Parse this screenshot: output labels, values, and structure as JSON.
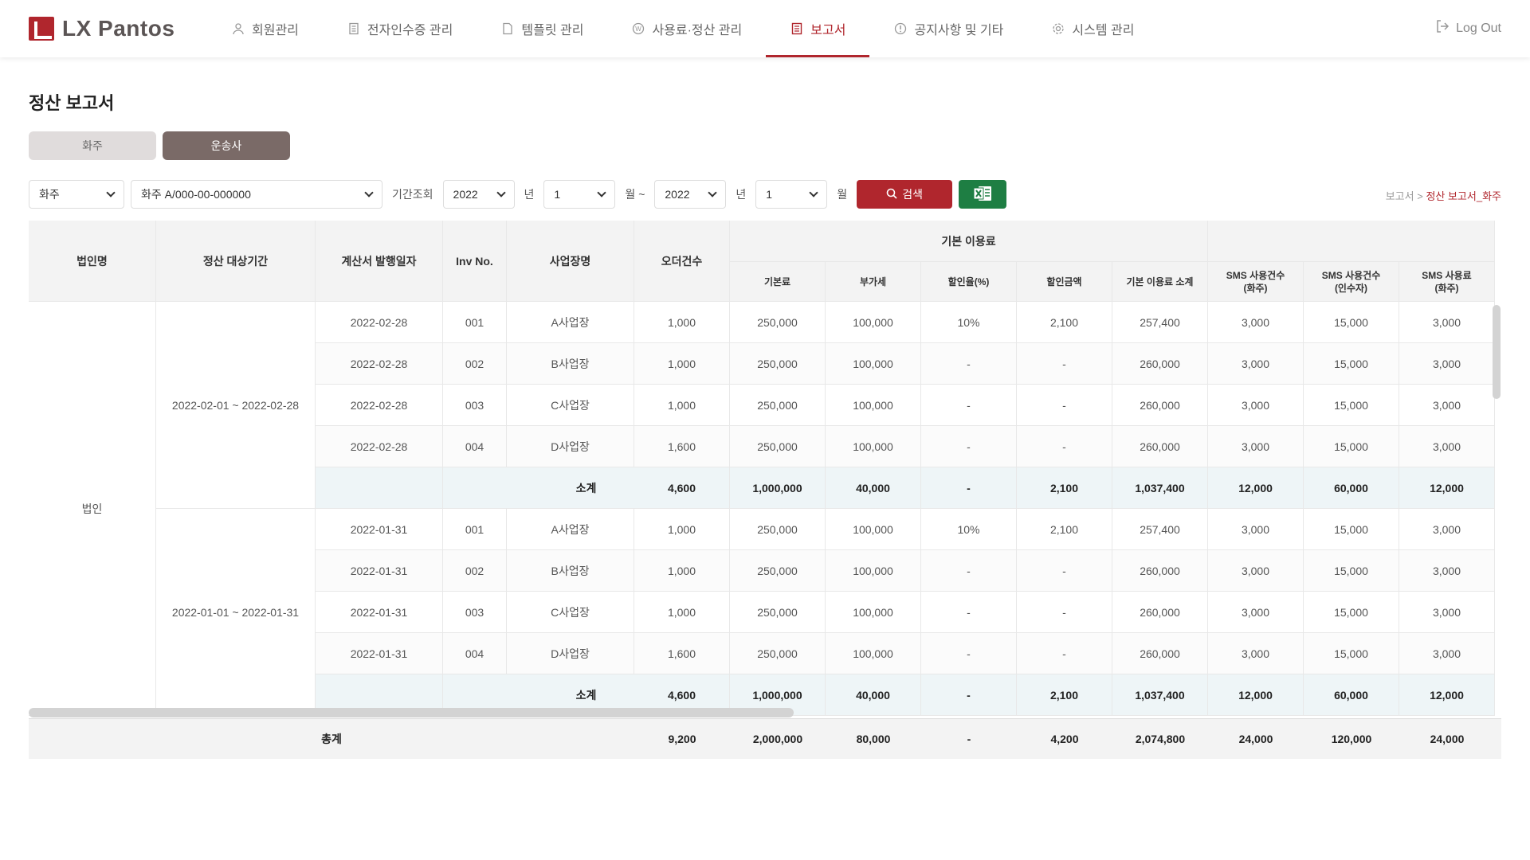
{
  "brand": {
    "name": "LX Pantos",
    "accent": "#b0262d"
  },
  "nav": [
    {
      "label": "회원관리",
      "icon": "user-icon",
      "active": false
    },
    {
      "label": "전자인수증 관리",
      "icon": "receipt-icon",
      "active": false
    },
    {
      "label": "템플릿 관리",
      "icon": "document-icon",
      "active": false
    },
    {
      "label": "사용료·정산 관리",
      "icon": "won-icon",
      "active": false
    },
    {
      "label": "보고서",
      "icon": "report-icon",
      "active": true
    },
    {
      "label": "공지사항 및 기타",
      "icon": "info-icon",
      "active": false
    },
    {
      "label": "시스템 관리",
      "icon": "gear-icon",
      "active": false
    }
  ],
  "logout": "Log Out",
  "page_title": "정산 보고서",
  "segments": {
    "shipper": "화주",
    "carrier": "운송사"
  },
  "filters": {
    "type": "화주",
    "company": "화주 A/000-00-000000",
    "period_label": "기간조회",
    "from_year": "2022",
    "year_unit": "년",
    "from_month": "1",
    "month_unit": "월 ~",
    "to_year": "2022",
    "to_month": "1",
    "month_unit_end": "월",
    "search_label": "검색"
  },
  "breadcrumb": {
    "parent": "보고서 >",
    "current": "정산 보고서_화주"
  },
  "table": {
    "headers": {
      "corp": "법인명",
      "period": "정산 대상기간",
      "issue_date": "계산서 발행일자",
      "inv": "Inv No.",
      "site": "사업장명",
      "orders": "오더건수",
      "basic_group": "기본 이용료",
      "base": "기본료",
      "vat": "부가세",
      "disc_rate": "할인율(%)",
      "disc_amt": "할인금액",
      "basic_sub": "기본 이용료 소계",
      "sms_cnt_shipper": "SMS 사용건수\n(화주)",
      "sms_cnt_receiver": "SMS 사용건수\n(인수자)",
      "sms_fee_shipper": "SMS 사용료\n(화주)"
    },
    "corp_name": "법인",
    "groups": [
      {
        "period": "2022-02-01 ~ 2022-02-28",
        "rows": [
          [
            "2022-02-28",
            "001",
            "A사업장",
            "1,000",
            "250,000",
            "100,000",
            "10%",
            "2,100",
            "257,400",
            "3,000",
            "15,000",
            "3,000"
          ],
          [
            "2022-02-28",
            "002",
            "B사업장",
            "1,000",
            "250,000",
            "100,000",
            "-",
            "-",
            "260,000",
            "3,000",
            "15,000",
            "3,000"
          ],
          [
            "2022-02-28",
            "003",
            "C사업장",
            "1,000",
            "250,000",
            "100,000",
            "-",
            "-",
            "260,000",
            "3,000",
            "15,000",
            "3,000"
          ],
          [
            "2022-02-28",
            "004",
            "D사업장",
            "1,600",
            "250,000",
            "100,000",
            "-",
            "-",
            "260,000",
            "3,000",
            "15,000",
            "3,000"
          ]
        ],
        "subtotal": [
          "소계",
          "4,600",
          "1,000,000",
          "40,000",
          "-",
          "2,100",
          "1,037,400",
          "12,000",
          "60,000",
          "12,000"
        ]
      },
      {
        "period": "2022-01-01 ~ 2022-01-31",
        "rows": [
          [
            "2022-01-31",
            "001",
            "A사업장",
            "1,000",
            "250,000",
            "100,000",
            "10%",
            "2,100",
            "257,400",
            "3,000",
            "15,000",
            "3,000"
          ],
          [
            "2022-01-31",
            "002",
            "B사업장",
            "1,000",
            "250,000",
            "100,000",
            "-",
            "-",
            "260,000",
            "3,000",
            "15,000",
            "3,000"
          ],
          [
            "2022-01-31",
            "003",
            "C사업장",
            "1,000",
            "250,000",
            "100,000",
            "-",
            "-",
            "260,000",
            "3,000",
            "15,000",
            "3,000"
          ],
          [
            "2022-01-31",
            "004",
            "D사업장",
            "1,600",
            "250,000",
            "100,000",
            "-",
            "-",
            "260,000",
            "3,000",
            "15,000",
            "3,000"
          ]
        ],
        "subtotal": [
          "소계",
          "4,600",
          "1,000,000",
          "40,000",
          "-",
          "2,100",
          "1,037,400",
          "12,000",
          "60,000",
          "12,000"
        ]
      }
    ],
    "total": [
      "총계",
      "9,200",
      "2,000,000",
      "80,000",
      "-",
      "4,200",
      "2,074,800",
      "24,000",
      "120,000",
      "24,000"
    ]
  }
}
